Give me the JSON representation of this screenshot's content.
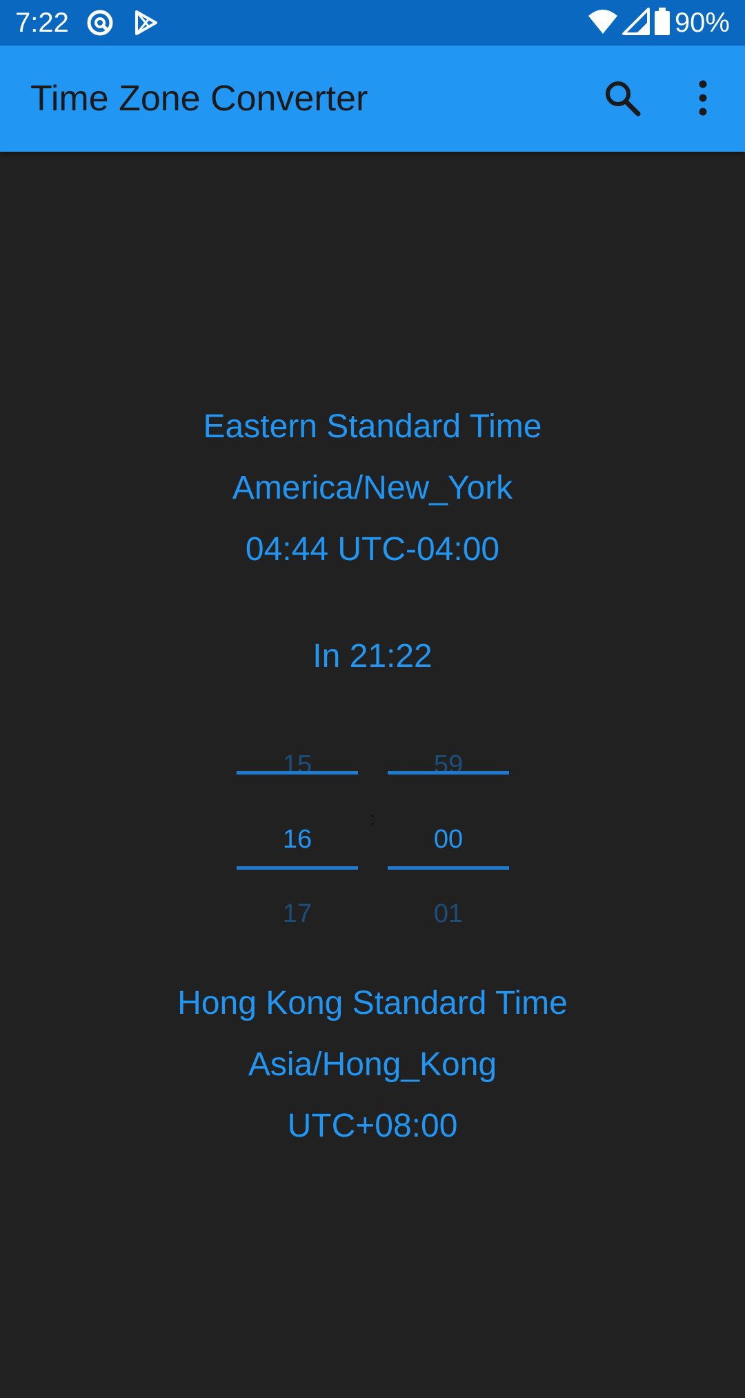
{
  "status_bar": {
    "time": "7:22",
    "battery": "90%",
    "icons": [
      "sync-icon",
      "play-store-icon",
      "wifi-icon",
      "signal-icon",
      "battery-icon"
    ]
  },
  "app_bar": {
    "title": "Time Zone Converter",
    "actions": [
      "search-icon",
      "more-vert-icon"
    ],
    "background": "#2196f3"
  },
  "source_zone": {
    "name": "Eastern Standard Time",
    "id": "America/New_York",
    "time_offset": "04:44 UTC-04:00"
  },
  "in_time": "In 21:22",
  "time_picker": {
    "hour": {
      "prev": "15",
      "selected": "16",
      "next": "17"
    },
    "minute": {
      "prev": "59",
      "selected": "00",
      "next": "01"
    },
    "separator": ":"
  },
  "target_zone": {
    "name": "Hong Kong Standard Time",
    "id": "Asia/Hong_Kong",
    "offset": "UTC+08:00"
  },
  "colors": {
    "accent": "#2196f3",
    "status_bar": "#0a68c0",
    "background": "#212121"
  }
}
